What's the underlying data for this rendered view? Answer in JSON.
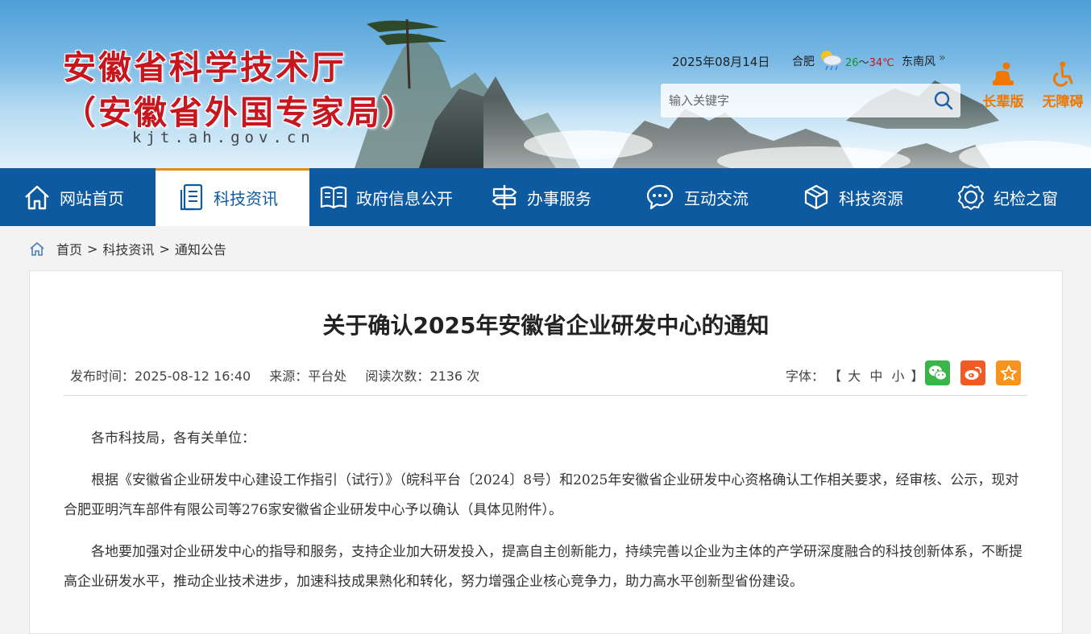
{
  "header": {
    "title_line1": "安徽省科学技术厅",
    "title_line2": "（安徽省外国专家局）",
    "domain": "kjt.ah.gov.cn",
    "date": "2025年08月14日",
    "city": "合肥",
    "weather_icon": "sun-cloud-rain-icon",
    "temp_low": "26",
    "temp_sep": "～",
    "temp_high": "34℃",
    "wind": "东南风",
    "wind_more": "»",
    "search_placeholder": "输入关键字",
    "elder_label": "长辈版",
    "access_label": "无障碍"
  },
  "nav": {
    "items": [
      {
        "label": "网站首页",
        "icon": "home-icon"
      },
      {
        "label": "科技资讯",
        "icon": "document-icon",
        "active": true
      },
      {
        "label": "政府信息公开",
        "icon": "book-icon"
      },
      {
        "label": "办事服务",
        "icon": "signpost-icon"
      },
      {
        "label": "互动交流",
        "icon": "chat-icon"
      },
      {
        "label": "科技资源",
        "icon": "cube-icon"
      },
      {
        "label": "纪检之窗",
        "icon": "gear-badge-icon"
      }
    ]
  },
  "breadcrumb": {
    "home": "首页",
    "sep": ">",
    "level1": "科技资讯",
    "level2": "通知公告"
  },
  "article": {
    "title": "关于确认2025年安徽省企业研发中心的通知",
    "publish_time": "发布时间：2025-08-12 16:40",
    "source": "来源：平台处",
    "views": "阅读次数：2136 次",
    "font_label": "字体：",
    "font_open": "【",
    "font_large": "大",
    "font_medium": "中",
    "font_small": "小",
    "font_close": "】",
    "share_icons": [
      "wechat-icon",
      "weibo-icon",
      "favorite-icon"
    ],
    "paragraphs": [
      "各市科技局，各有关单位：",
      "根据《安徽省企业研发中心建设工作指引（试行）》（皖科平台〔2024〕8号）和2025年安徽省企业研发中心资格确认工作相关要求，经审核、公示，现对合肥亚明汽车部件有限公司等276家安徽省企业研发中心予以确认（具体见附件）。",
      "各地要加强对企业研发中心的指导和服务，支持企业加大研发投入，提高自主创新能力，持续完善以企业为主体的产学研深度融合的科技创新体系，不断提高企业研发水平，推动企业技术进步，加速科技成果熟化和转化，努力增强企业核心竞争力，助力高水平创新型省份建设。"
    ]
  },
  "colors": {
    "nav_bg": "#0e5aa0",
    "title_red": "#c7161d",
    "tool_orange": "#f07800",
    "active_bar": "#e48b1b"
  }
}
